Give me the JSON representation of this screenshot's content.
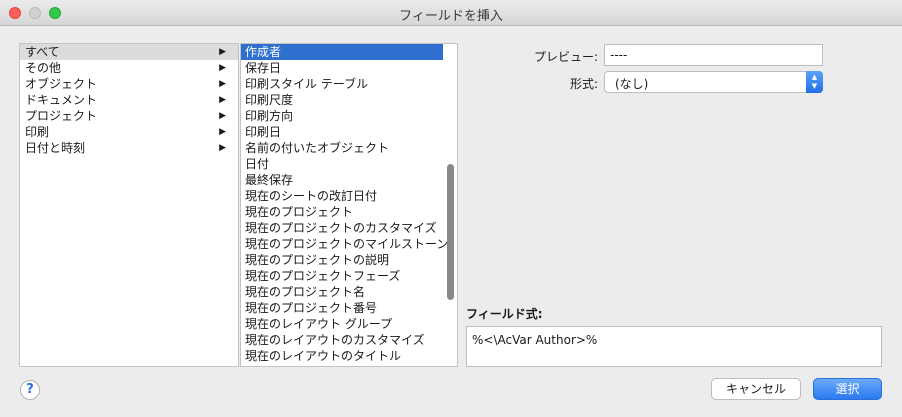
{
  "window": {
    "title": "フィールドを挿入"
  },
  "categories": [
    {
      "label": "すべて",
      "selected": true
    },
    {
      "label": "その他",
      "selected": false
    },
    {
      "label": "オブジェクト",
      "selected": false
    },
    {
      "label": "ドキュメント",
      "selected": false
    },
    {
      "label": "プロジェクト",
      "selected": false
    },
    {
      "label": "印刷",
      "selected": false
    },
    {
      "label": "日付と時刻",
      "selected": false
    }
  ],
  "category_arrow": "▶",
  "fields": [
    {
      "label": "作成者",
      "selected": true
    },
    {
      "label": "保存日",
      "selected": false
    },
    {
      "label": "印刷スタイル テーブル",
      "selected": false
    },
    {
      "label": "印刷尺度",
      "selected": false
    },
    {
      "label": "印刷方向",
      "selected": false
    },
    {
      "label": "印刷日",
      "selected": false
    },
    {
      "label": "名前の付いたオブジェクト",
      "selected": false
    },
    {
      "label": "日付",
      "selected": false
    },
    {
      "label": "最終保存",
      "selected": false
    },
    {
      "label": "現在のシートの改訂日付",
      "selected": false
    },
    {
      "label": "現在のプロジェクト",
      "selected": false
    },
    {
      "label": "現在のプロジェクトのカスタマイズ",
      "selected": false
    },
    {
      "label": "現在のプロジェクトのマイルストーン",
      "selected": false
    },
    {
      "label": "現在のプロジェクトの説明",
      "selected": false
    },
    {
      "label": "現在のプロジェクトフェーズ",
      "selected": false
    },
    {
      "label": "現在のプロジェクト名",
      "selected": false
    },
    {
      "label": "現在のプロジェクト番号",
      "selected": false
    },
    {
      "label": "現在のレイアウト グループ",
      "selected": false
    },
    {
      "label": "現在のレイアウトのカスタマイズ",
      "selected": false
    },
    {
      "label": "現在のレイアウトのタイトル",
      "selected": false
    }
  ],
  "preview": {
    "label": "プレビュー:",
    "value": "----"
  },
  "format": {
    "label": "形式:",
    "value": "(なし)",
    "stepper_up": "▲",
    "stepper_down": "▼"
  },
  "expression": {
    "label": "フィールド式:",
    "value": "%<\\AcVar Author>%"
  },
  "help": {
    "glyph": "?"
  },
  "buttons": {
    "cancel": "キャンセル",
    "select": "選択"
  },
  "colors": {
    "selection": "#2f6fcd",
    "primary_button": "#2a79ee"
  }
}
